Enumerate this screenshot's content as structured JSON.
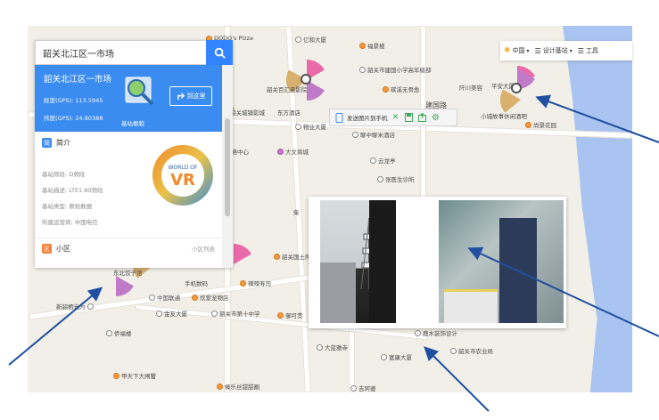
{
  "search": {
    "value": "韶关北江区一市场"
  },
  "card": {
    "title": "韶关北江区一市场",
    "lng": "经度(GPS): 113.5945",
    "lat": "纬度(GPS): 24.80388",
    "lens_label": "基站概貌",
    "go_label": "到这里"
  },
  "intro": {
    "badge": "简",
    "title": "简介",
    "lines": [
      "基站频段: D频段",
      "基站描述: LTE1.80频段",
      "基站类型: 原始数据",
      "所属运营商: 中国电信"
    ]
  },
  "cell": {
    "badge": "区",
    "title": "小区",
    "list_link": "小区列表"
  },
  "vr_logo": {
    "top": "WORLD OF",
    "main": "VR"
  },
  "toolbar": {
    "region": "中国",
    "design": "设计基站",
    "tools": "工具"
  },
  "mini_toolbar": {
    "send_label": "发送图片到手机"
  },
  "map_pois": [
    "DODO's Pizza",
    "亿和大厦",
    "福景楼",
    "韶关市建国小学高年级部",
    "碳溪无骨鱼",
    "建国路",
    "韶关百汇电影院",
    "东方酒店",
    "韶关城镇影城",
    "物业大厦",
    "聊中聊米酒店",
    "龙鹏网络中心",
    "大文商城",
    "云龙亭",
    "张医生诊所",
    "柴",
    "平安大厦",
    "小城故事休闲酒吧",
    "尚景花园",
    "阡川美容",
    "东北饺子馆",
    "中国联通",
    "欣爱宠物店",
    "金友大厦",
    "韶关市第十中学",
    "御可贵",
    "新韶栖光为",
    "侨福楼",
    "甲天下大闸蟹",
    "榛乐丝甜甜圈",
    "吉阿婆",
    "大蓝雅寺",
    "富康大厦",
    "韶关市农业局",
    "鹿木装饰设计",
    "手机数码",
    "辣辣寿司",
    "韶关国土所"
  ]
}
